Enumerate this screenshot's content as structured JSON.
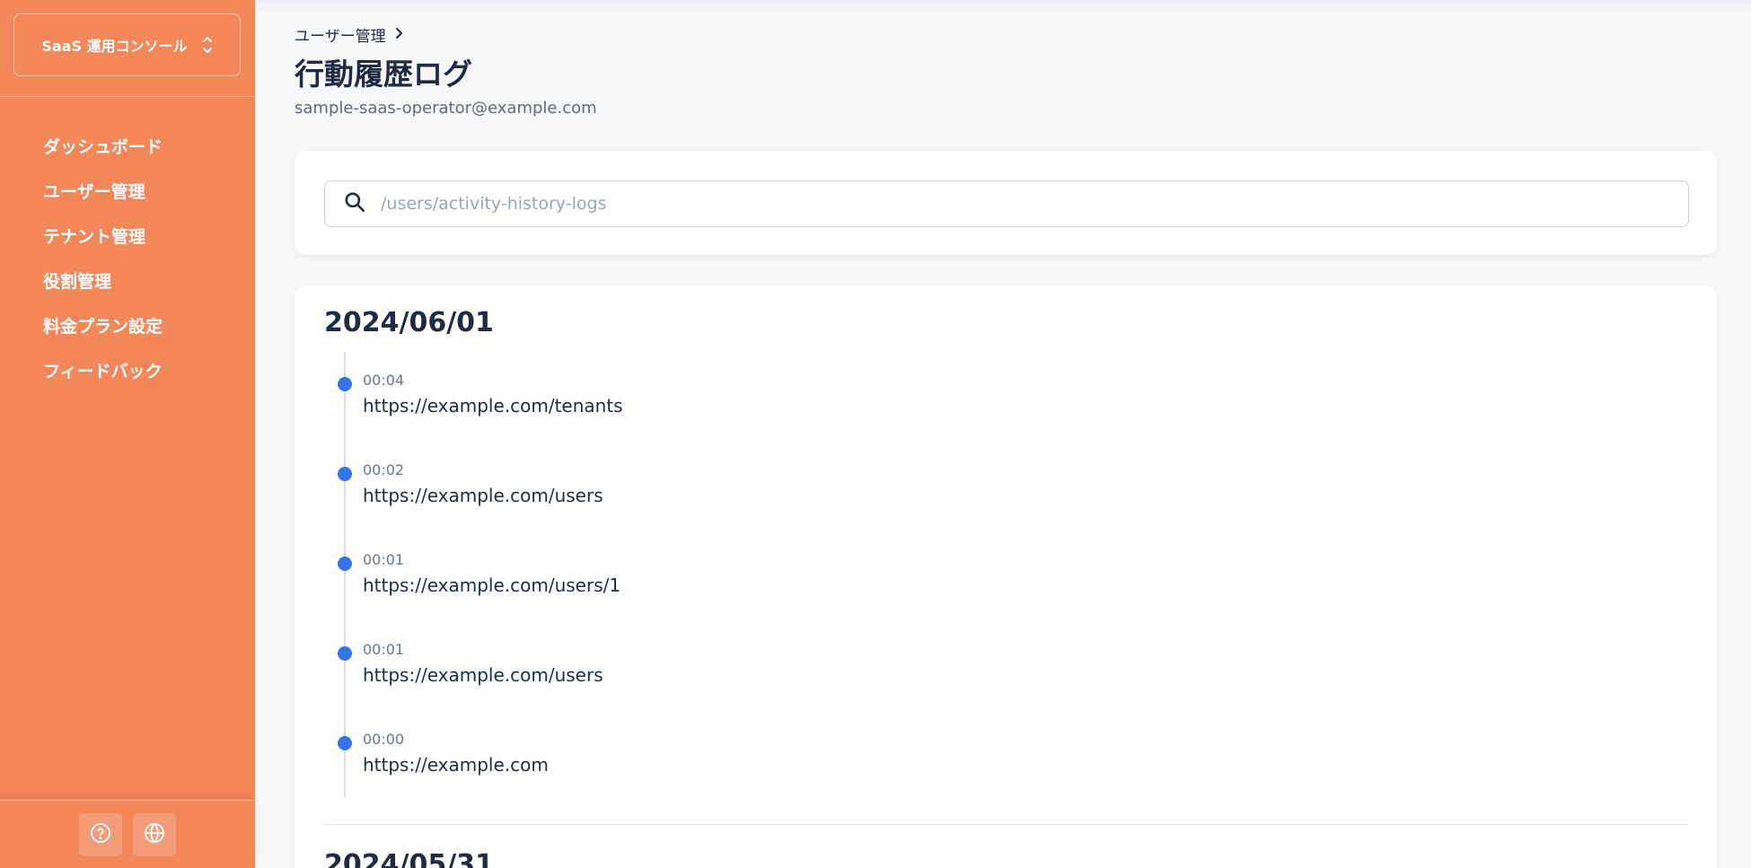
{
  "sidebar": {
    "console_label": "SaaS 運用コンソール",
    "nav": [
      {
        "label": "ダッシュボード"
      },
      {
        "label": "ユーザー管理"
      },
      {
        "label": "テナント管理"
      },
      {
        "label": "役割管理"
      },
      {
        "label": "料金プラン設定"
      },
      {
        "label": "フィードバック"
      }
    ],
    "bottom_icons": [
      "help-circle-icon",
      "globe-icon"
    ]
  },
  "header": {
    "breadcrumb": "ユーザー管理",
    "title": "行動履歴ログ",
    "subtitle": "sample-saas-operator@example.com"
  },
  "search": {
    "placeholder": "/users/activity-history-logs",
    "value": ""
  },
  "logs": [
    {
      "date": "2024/06/01",
      "entries": [
        {
          "time": "00:04",
          "url": "https://example.com/tenants"
        },
        {
          "time": "00:02",
          "url": "https://example.com/users"
        },
        {
          "time": "00:01",
          "url": "https://example.com/users/1"
        },
        {
          "time": "00:01",
          "url": "https://example.com/users"
        },
        {
          "time": "00:00",
          "url": "https://example.com"
        }
      ]
    },
    {
      "date": "2024/05/31",
      "entries": []
    }
  ],
  "colors": {
    "sidebar": "#f2875a",
    "accent_dot": "#3575e6",
    "text": "#1f2a44"
  }
}
